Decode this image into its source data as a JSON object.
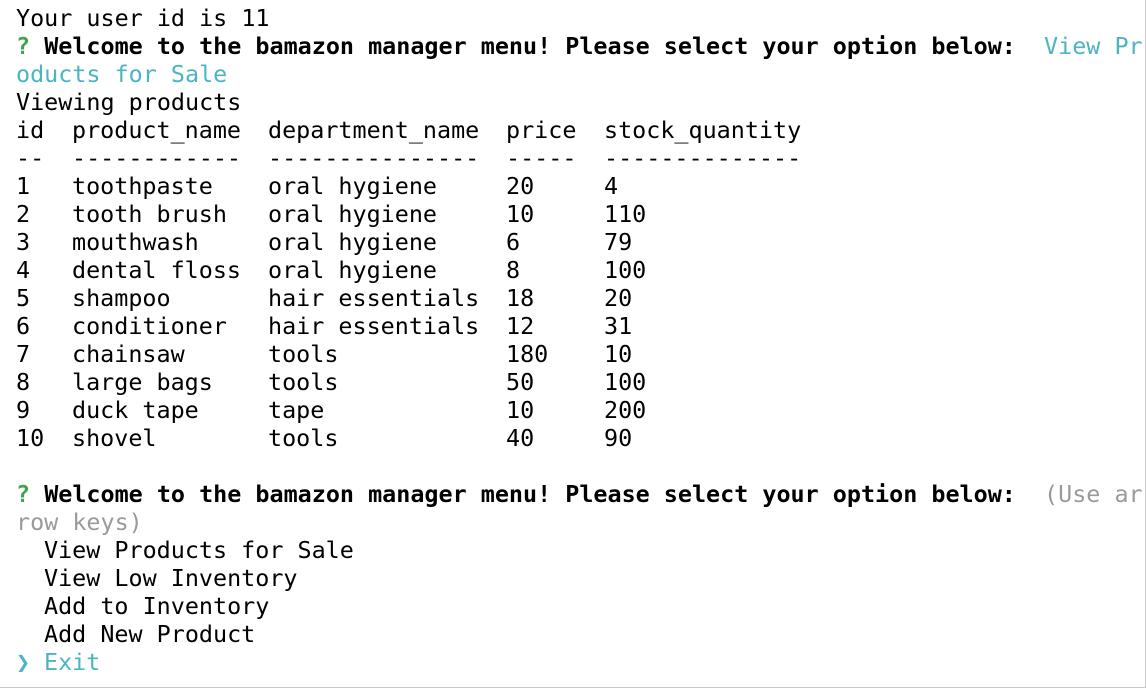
{
  "session": {
    "user_line": "Your user id is 11"
  },
  "prompt1": {
    "marker": "?",
    "question": "Welcome to the bamazon manager menu! Please select your option below:",
    "answer_part1": "View Pr",
    "answer_part2": "oducts for Sale"
  },
  "status": "Viewing products",
  "table": {
    "headers": [
      "id",
      "product_name",
      "department_name",
      "price",
      "stock_quantity"
    ],
    "separators": [
      "--",
      "------------",
      "---------------",
      "-----",
      "--------------"
    ],
    "rows": [
      [
        "1",
        "toothpaste",
        "oral hygiene",
        "20",
        "4"
      ],
      [
        "2",
        "tooth brush",
        "oral hygiene",
        "10",
        "110"
      ],
      [
        "3",
        "mouthwash",
        "oral hygiene",
        "6",
        "79"
      ],
      [
        "4",
        "dental floss",
        "oral hygiene",
        "8",
        "100"
      ],
      [
        "5",
        "shampoo",
        "hair essentials",
        "18",
        "20"
      ],
      [
        "6",
        "conditioner",
        "hair essentials",
        "12",
        "31"
      ],
      [
        "7",
        "chainsaw",
        "tools",
        "180",
        "10"
      ],
      [
        "8",
        "large bags",
        "tools",
        "50",
        "100"
      ],
      [
        "9",
        "duck tape",
        "tape",
        "10",
        "200"
      ],
      [
        "10",
        "shovel",
        "tools",
        "40",
        "90"
      ]
    ]
  },
  "prompt2": {
    "marker": "?",
    "question": "Welcome to the bamazon manager menu! Please select your option below:",
    "hint_part1": "(Use ar",
    "hint_part2": "row keys)"
  },
  "menu": {
    "pointer": "❯",
    "options": [
      "View Products for Sale",
      "View Low Inventory",
      "Add to Inventory",
      "Add New Product",
      "Exit"
    ],
    "selected_index": 4
  },
  "colors": {
    "question_mark": "#3fa34d",
    "answer": "#4bb5c1",
    "hint": "#9a9a9a"
  }
}
